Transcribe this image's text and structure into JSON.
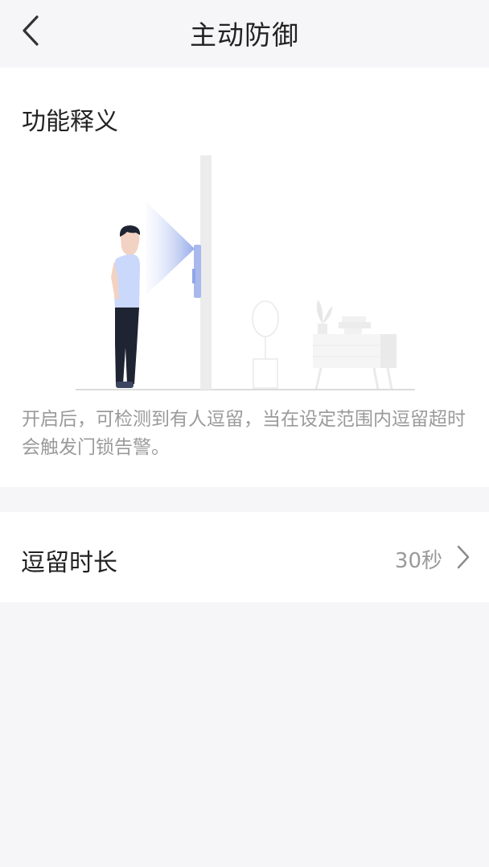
{
  "header": {
    "title": "主动防御",
    "back_icon": "chevron-left-icon"
  },
  "explanation": {
    "title": "功能释义",
    "description": "开启后，可检测到有人逗留，当在设定范围内逗留超时会触发门锁告警。"
  },
  "settings": {
    "stay_duration": {
      "label": "逗留时长",
      "value": "30秒",
      "icon": "chevron-right-icon"
    }
  },
  "colors": {
    "background": "#f6f6f8",
    "card": "#ffffff",
    "text_primary": "#222222",
    "text_secondary": "#9a9a9a",
    "accent_blue": "#8fa6e8"
  }
}
